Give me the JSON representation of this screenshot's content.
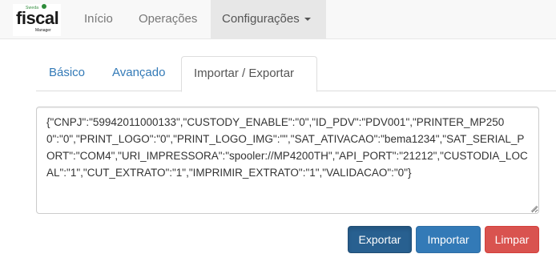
{
  "logo": {
    "top_text": "Sweda",
    "main_text": "fiscal",
    "sub_text": "Manager"
  },
  "navbar": {
    "items": [
      {
        "label": "Início"
      },
      {
        "label": "Operações"
      },
      {
        "label": "Configurações"
      }
    ]
  },
  "tabs": [
    {
      "label": "Básico"
    },
    {
      "label": "Avançado"
    },
    {
      "label": "Importar / Exportar"
    }
  ],
  "config_text": "{\"CNPJ\":\"59942011000133\",\"CUSTODY_ENABLE\":\"0\",\"ID_PDV\":\"PDV001\",\"PRINTER_MP2500\":\"0\",\"PRINT_LOGO\":\"0\",\"PRINT_LOGO_IMG\":\"\",\"SAT_ATIVACAO\":\"bema1234\",\"SAT_SERIAL_PORT\":\"COM4\",\"URI_IMPRESSORA\":\"spooler://MP4200TH\",\"API_PORT\":\"21212\",\"CUSTODIA_LOCAL\":\"1\",\"CUT_EXTRATO\":\"1\",\"IMPRIMIR_EXTRATO\":\"1\",\"VALIDACAO\":\"0\"}",
  "buttons": {
    "export": "Exportar",
    "import": "Importar",
    "clear": "Limpar"
  },
  "colors": {
    "link": "#337ab7",
    "primary_active": "#286090",
    "primary": "#337ab7",
    "danger": "#d9534f",
    "brand_green": "#2e8b3a"
  }
}
